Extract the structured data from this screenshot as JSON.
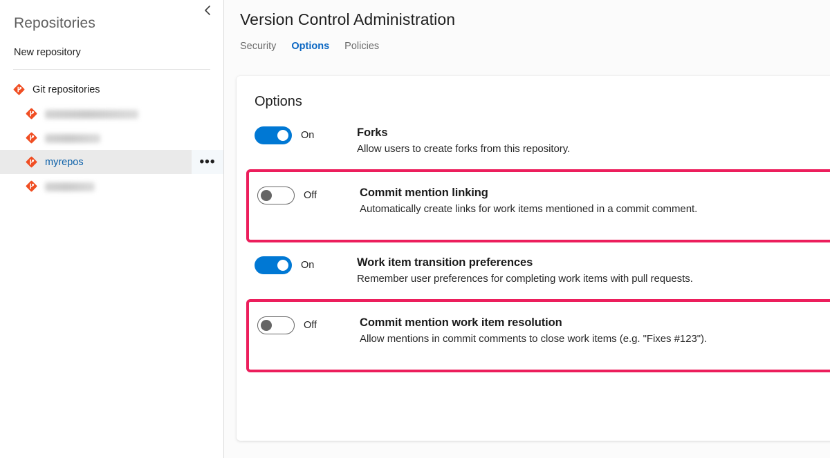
{
  "sidebar": {
    "title": "Repositories",
    "collapse_icon": "chevron-left-icon",
    "new_repository_label": "New repository",
    "tree": [
      {
        "label": "Git repositories",
        "level": "root",
        "redacted": false,
        "selected": false,
        "icon": "git-repository-icon"
      },
      {
        "label": "azuredevops-sample",
        "level": "child",
        "redacted": true,
        "selected": false,
        "icon": "git-repository-icon"
      },
      {
        "label": "dotfiles-repo",
        "level": "child",
        "redacted": true,
        "selected": false,
        "icon": "git-repository-icon"
      },
      {
        "label": "myrepos",
        "level": "child",
        "redacted": false,
        "selected": true,
        "icon": "git-repository-icon",
        "overflow_label": "•••"
      },
      {
        "label": "TestProject",
        "level": "child",
        "redacted": true,
        "selected": false,
        "icon": "git-repository-icon"
      }
    ]
  },
  "header": {
    "title": "Version Control Administration",
    "tabs": [
      {
        "label": "Security",
        "active": false
      },
      {
        "label": "Options",
        "active": true
      },
      {
        "label": "Policies",
        "active": false
      }
    ]
  },
  "card": {
    "heading": "Options",
    "options": [
      {
        "toggle_state": "On",
        "enabled": true,
        "highlighted": false,
        "title": "Forks",
        "description": "Allow users to create forks from this repository."
      },
      {
        "toggle_state": "Off",
        "enabled": false,
        "highlighted": true,
        "title": "Commit mention linking",
        "description": "Automatically create links for work items mentioned in a commit comment."
      },
      {
        "toggle_state": "On",
        "enabled": true,
        "highlighted": false,
        "title": "Work item transition preferences",
        "description": "Remember user preferences for completing work items with pull requests."
      },
      {
        "toggle_state": "Off",
        "enabled": false,
        "highlighted": true,
        "title": "Commit mention work item resolution",
        "description": "Allow mentions in commit comments to close work items (e.g. \"Fixes #123\")."
      }
    ]
  },
  "colors": {
    "accent_blue": "#0078d4",
    "link_blue": "#0a5fa8",
    "tab_active": "#0a66c2",
    "highlight_pink": "#ec1e5c",
    "git_icon_orange": "#f04e23",
    "selected_row_bg": "#eaeaea",
    "page_bg": "#fbfbfb"
  }
}
